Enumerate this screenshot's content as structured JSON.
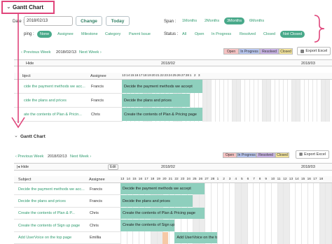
{
  "top": {
    "title": "Gantt Chart",
    "date_label": "Date :",
    "date_value": "2018/02/13",
    "change_label": "Change",
    "today_label": "Today",
    "span_label": "Span :",
    "spans": [
      "1Months",
      "2Months",
      "3Months",
      "6Months"
    ],
    "span_active": 2,
    "grouping_label": "ping :",
    "groupings": [
      "None",
      "Assignee",
      "Milestone",
      "Category",
      "Parent Issue"
    ],
    "status_label": "Status :",
    "statuses": [
      "All",
      "Open",
      "In Progress",
      "Resolved",
      "Closed",
      "Not Closed"
    ],
    "prev_label": "Previous Week",
    "week_date": "2018/02/13",
    "next_label": "Next Week",
    "legend": [
      {
        "label": "Open",
        "color": "#f6c2c2"
      },
      {
        "label": "In Progress",
        "color": "#b8c6f0"
      },
      {
        "label": "Resolved",
        "color": "#c9b3e6"
      },
      {
        "label": "Closed",
        "color": "#f3e39a"
      }
    ],
    "export_label": "Export Excel",
    "hide_label": "Hide",
    "month_left": "2018/02",
    "month_right": "2018/03",
    "col_subject": "bject",
    "col_assignee": "Assignee",
    "days": [
      "13",
      "14",
      "15",
      "16",
      "17",
      "18",
      "19",
      "20",
      "21",
      "22",
      "23",
      "24",
      "25",
      "26",
      "27",
      "28",
      "1",
      "2",
      "3"
    ],
    "rows": [
      {
        "subject": "cide the payment methods we acc...",
        "assignee": "Francis",
        "bar": "Decide the payment methods we accept"
      },
      {
        "subject": "cide the plans and prices",
        "assignee": "Francis",
        "bar": "Decide the plans and prices"
      },
      {
        "subject": "ate the contents of Plan & Pricin...",
        "assignee": "Chris",
        "bar": "Create the contents of Plan & Pricing page"
      }
    ]
  },
  "bottom": {
    "title": "Gantt Chart",
    "prev_label": "Previous Week",
    "week_date": "2018/02/13",
    "next_label": "Next Week",
    "legend": [
      {
        "label": "Open",
        "color": "#f6c2c2"
      },
      {
        "label": "In Progress",
        "color": "#b8c6f0"
      },
      {
        "label": "Resolved",
        "color": "#c9b3e6"
      },
      {
        "label": "Closed",
        "color": "#f3e39a"
      }
    ],
    "export_label": "Export Excel",
    "hide_label": "Hide",
    "edit_label": "Edit",
    "month_left": "2018/02",
    "month_right": "2018/03",
    "col_subject": "Subject",
    "col_assignee": "Assignee",
    "days": [
      "13",
      "14",
      "15",
      "16",
      "17",
      "18",
      "19",
      "20",
      "21",
      "22",
      "23",
      "24",
      "25",
      "26",
      "27",
      "28",
      "1",
      "2",
      "3",
      "4",
      "5",
      "6",
      "7",
      "8",
      "9",
      "10",
      "11",
      "12",
      "13",
      "14",
      "15",
      "16",
      "17",
      "18"
    ],
    "rows": [
      {
        "subject": "Decide the payment methods we acc...",
        "assignee": "Francis",
        "bar": "Decide the payment methods we accept"
      },
      {
        "subject": "Decide the plans and prices",
        "assignee": "Francis",
        "bar": "Decide the plans and prices"
      },
      {
        "subject": "Create the contents of Plan & P...",
        "assignee": "Chris",
        "bar": "Create the contents of Plan & Pricing page"
      },
      {
        "subject": "Create the contents of Sign up page",
        "assignee": "Chris",
        "bar": "Create the contents of Sign up page"
      },
      {
        "subject": "Add UserVoice on the top page",
        "assignee": "Emillia",
        "bar": "Add UserVoice on the top page"
      }
    ]
  },
  "colors": {
    "accent": "#2e9b6e",
    "highlight": "#e0457b",
    "bar": "#8ecfbd"
  }
}
